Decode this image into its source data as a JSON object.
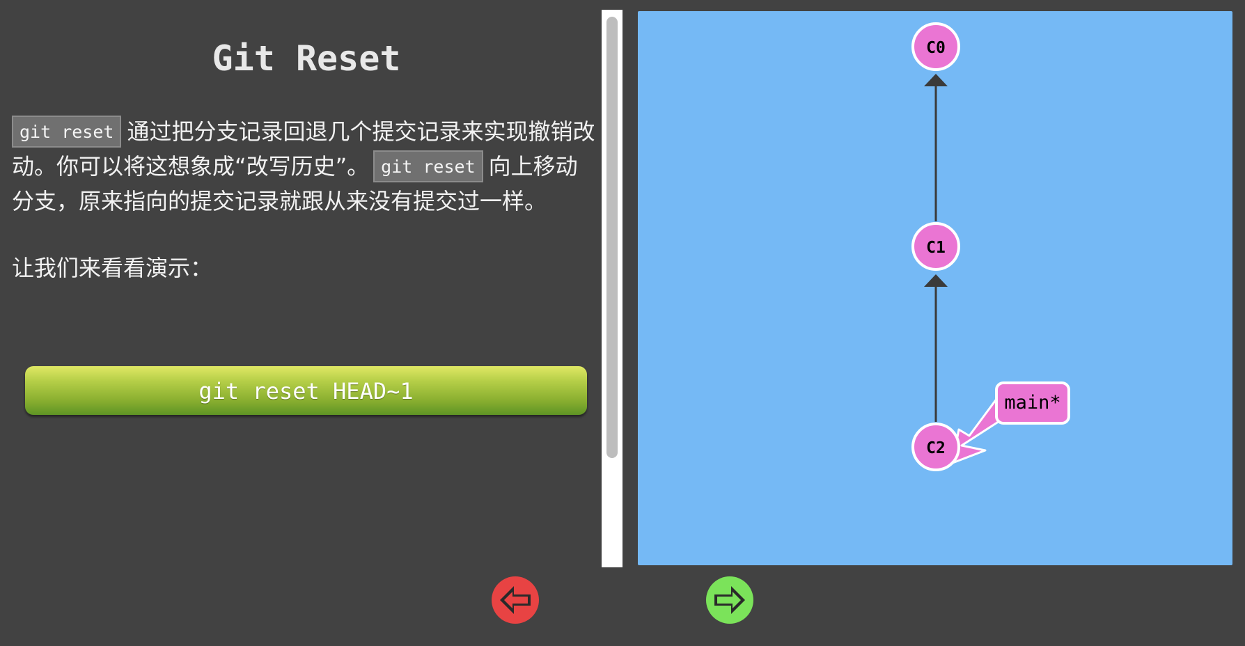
{
  "lesson": {
    "title": "Git Reset",
    "paragraph1": {
      "code1": "git reset",
      "text1": "通过把分支记录回退几个提交记录来实现撤销改动。你可以将这想象成“改写历史”。",
      "code2": "git reset",
      "text2": "向上移动分支，原来指向的提交记录就跟从来没有提交过一样。"
    },
    "paragraph2": "让我们来看看演示：",
    "command_button": "git reset HEAD~1"
  },
  "graph": {
    "background": "#75b9f5",
    "node_color": "#ea75d3",
    "commits": [
      "C0",
      "C1",
      "C2"
    ],
    "branch_label": "main*"
  },
  "navigation": {
    "prev_icon": "left-arrow-icon",
    "next_icon": "right-arrow-icon",
    "prev_color": "#e84343",
    "next_color": "#7be35a"
  }
}
